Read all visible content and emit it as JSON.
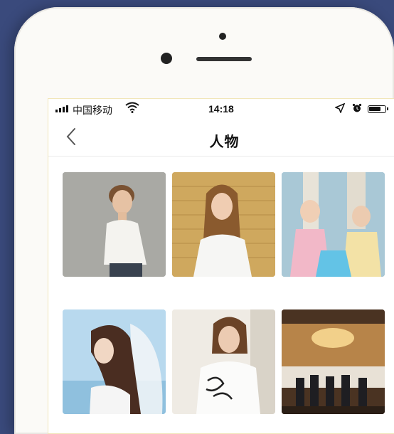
{
  "status_bar": {
    "carrier": "中国移动",
    "time": "14:18"
  },
  "nav": {
    "title": "人物",
    "back_icon": "chevron-left-icon"
  },
  "photos": [
    {
      "id": "person-1"
    },
    {
      "id": "person-2"
    },
    {
      "id": "person-3"
    },
    {
      "id": "person-4"
    },
    {
      "id": "person-5"
    },
    {
      "id": "person-6"
    }
  ],
  "colors": {
    "background": "#3a4a7c",
    "phone_body": "#fbfaf7"
  }
}
